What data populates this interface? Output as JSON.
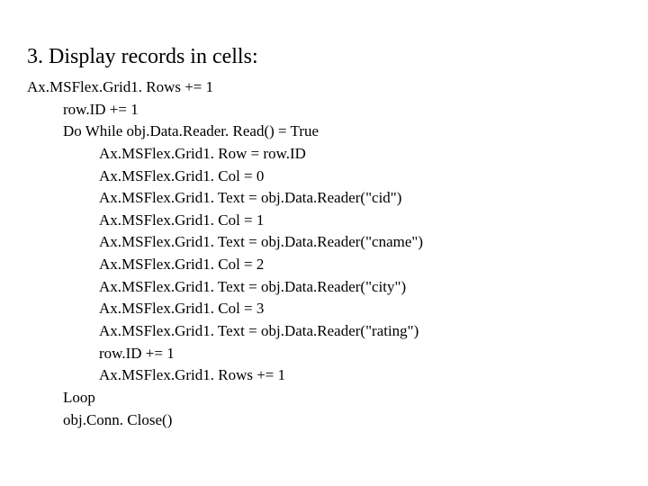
{
  "heading": "3. Display records in cells:",
  "code": {
    "l0": "Ax.MSFlex.Grid1. Rows += 1",
    "l1": "row.ID += 1",
    "l2": "Do While obj.Data.Reader. Read() = True",
    "l3": "Ax.MSFlex.Grid1. Row = row.ID",
    "l4": "Ax.MSFlex.Grid1. Col = 0",
    "l5": "Ax.MSFlex.Grid1. Text = obj.Data.Reader(\"cid\")",
    "l6": "Ax.MSFlex.Grid1. Col = 1",
    "l7": "Ax.MSFlex.Grid1. Text = obj.Data.Reader(\"cname\")",
    "l8": "Ax.MSFlex.Grid1. Col = 2",
    "l9": "Ax.MSFlex.Grid1. Text = obj.Data.Reader(\"city\")",
    "l10": "Ax.MSFlex.Grid1. Col = 3",
    "l11": "Ax.MSFlex.Grid1. Text = obj.Data.Reader(\"rating\")",
    "l12": "row.ID += 1",
    "l13": "Ax.MSFlex.Grid1. Rows += 1",
    "l14": "Loop",
    "l15": "obj.Conn. Close()"
  }
}
